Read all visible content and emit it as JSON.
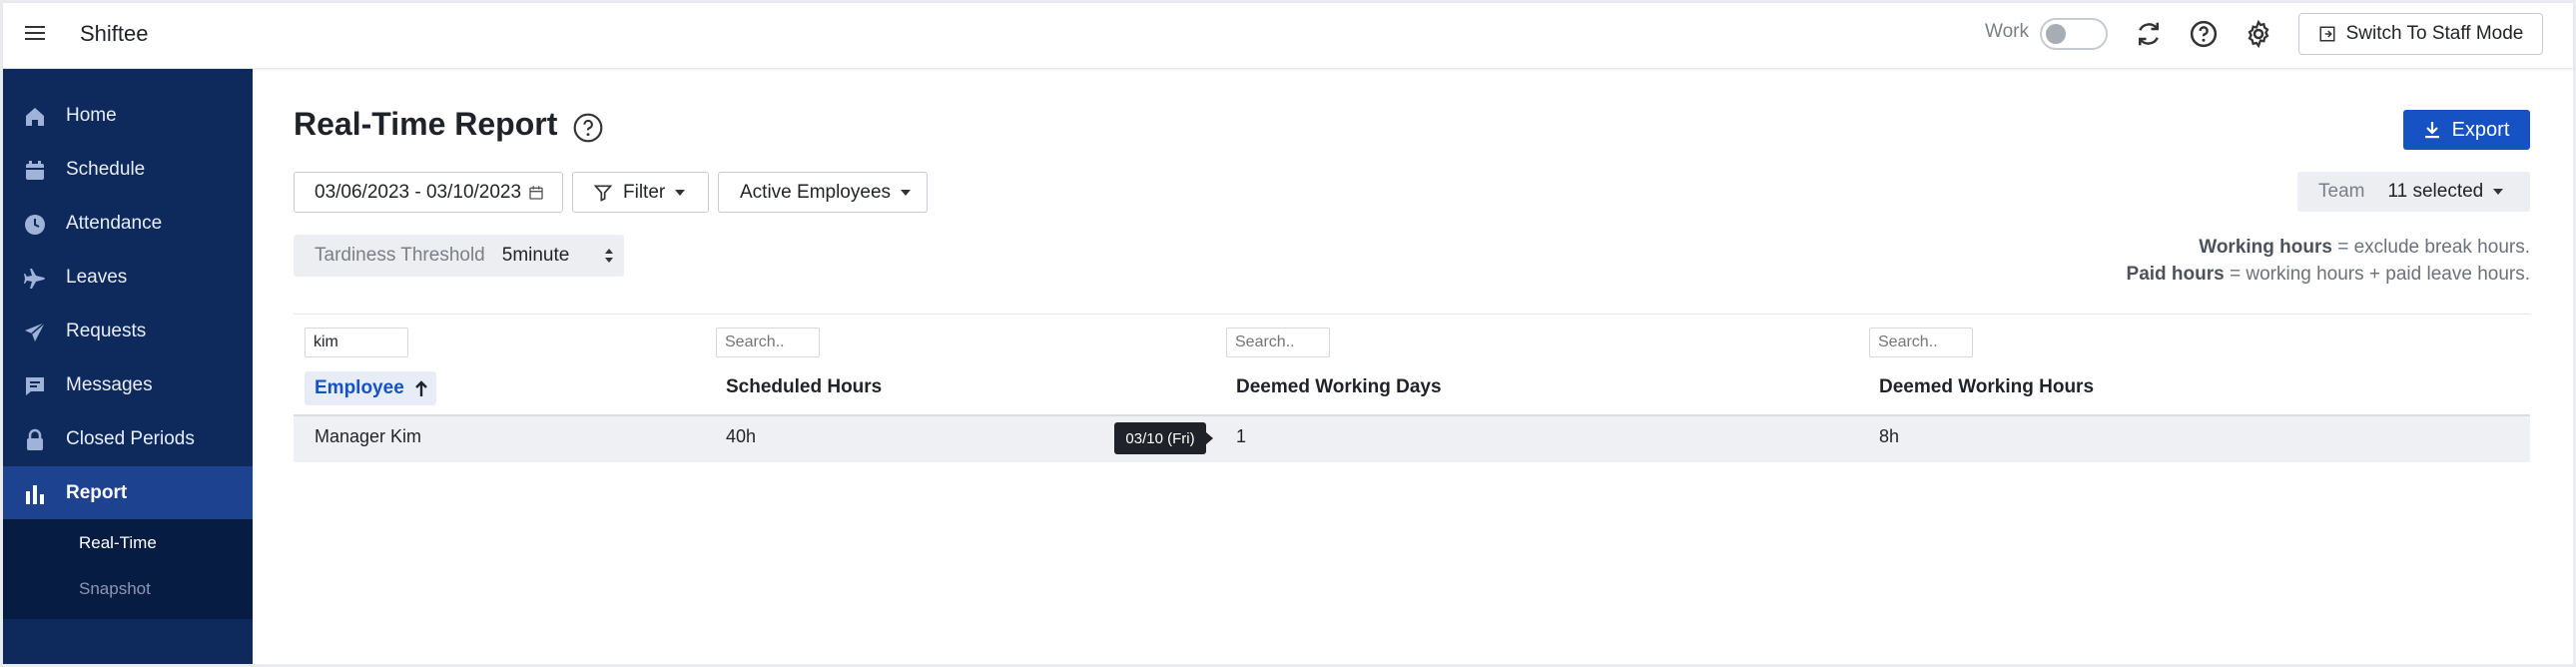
{
  "app": {
    "brand": "Shiftee"
  },
  "topbar": {
    "work_label": "Work",
    "work_toggle_on": false,
    "icons": [
      "refresh-icon",
      "help-icon",
      "gear-icon"
    ],
    "staff_mode_label": "Switch To Staff Mode"
  },
  "sidebar": {
    "items": [
      {
        "label": "Home",
        "icon": "home-icon"
      },
      {
        "label": "Schedule",
        "icon": "calendar-icon"
      },
      {
        "label": "Attendance",
        "icon": "clock-icon"
      },
      {
        "label": "Leaves",
        "icon": "airplane-icon"
      },
      {
        "label": "Requests",
        "icon": "send-icon"
      },
      {
        "label": "Messages",
        "icon": "message-icon"
      },
      {
        "label": "Closed Periods",
        "icon": "lock-icon"
      },
      {
        "label": "Report",
        "icon": "bar-chart-icon",
        "active": true
      }
    ],
    "subitems": [
      {
        "label": "Real-Time",
        "active": true
      },
      {
        "label": "Snapshot",
        "active": false
      }
    ]
  },
  "main": {
    "title": "Real-Time Report",
    "export_label": "Export",
    "date_range": "03/06/2023 - 03/10/2023",
    "filter_label": "Filter",
    "employees_filter": "Active Employees",
    "team_label": "Team",
    "team_value": "11 selected",
    "tardiness_label": "Tardiness Threshold",
    "tardiness_value": "5minute",
    "note1_bold": "Working hours",
    "note1_rest": " = exclude break hours.",
    "note2_bold": "Paid hours",
    "note2_rest": " = working hours + paid leave hours."
  },
  "table": {
    "search_values": [
      "kim",
      "",
      "",
      ""
    ],
    "search_placeholder": "Search..",
    "headers": [
      "Employee",
      "Scheduled Hours",
      "Deemed Working Days",
      "Deemed Working Hours"
    ],
    "sort": {
      "column": "Employee",
      "direction": "ascending"
    },
    "rows": [
      {
        "employee": "Manager Kim",
        "scheduled_hours": "40h",
        "deemed_days": "1",
        "deemed_hours": "8h"
      }
    ],
    "tooltip": "03/10 (Fri)"
  },
  "colors": {
    "sidebar_bg": "#0e2a5c",
    "sidebar_active": "#1d4290",
    "accent": "#1652c4"
  }
}
